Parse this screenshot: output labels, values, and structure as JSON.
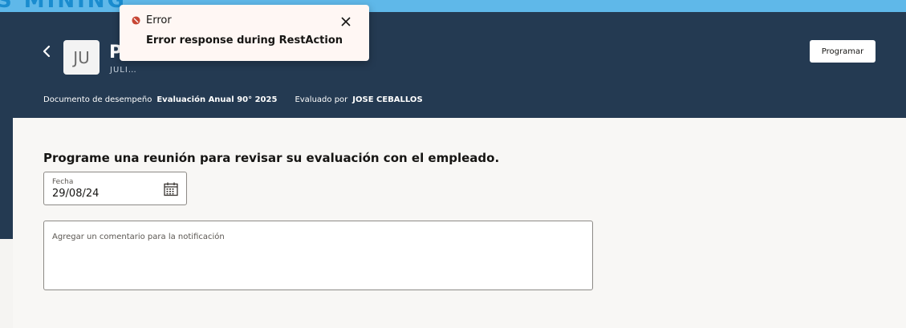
{
  "brand": {
    "text": "S MINING"
  },
  "header": {
    "back_icon": "chevron-left-icon",
    "avatar_initials": "JU",
    "employee_name": "P",
    "employee_subtitle": "JULI…",
    "schedule_button": "Programar",
    "meta": {
      "document_label": "Documento de desempeño",
      "document_value": "Evaluación Anual 90° 2025",
      "evaluator_label": "Evaluado por",
      "evaluator_value": "JOSE CEBALLOS"
    }
  },
  "main": {
    "title": "Programe una reunión para revisar su evaluación con el empleado.",
    "date_field": {
      "label": "Fecha",
      "value": "29/08/24",
      "icon": "calendar-icon"
    },
    "comment_field": {
      "placeholder": "Agregar un comentario para la notificación",
      "value": ""
    }
  },
  "toast": {
    "icon": "error-icon",
    "title": "Error",
    "message": "Error response during RestAction",
    "close_icon": "close-icon",
    "colors": {
      "icon": "#c74634",
      "background": "#fff7f4"
    }
  },
  "colors": {
    "header_bg": "#243a52",
    "top_strip": "#5fb8e9",
    "page_bg": "#f5f4f2"
  }
}
